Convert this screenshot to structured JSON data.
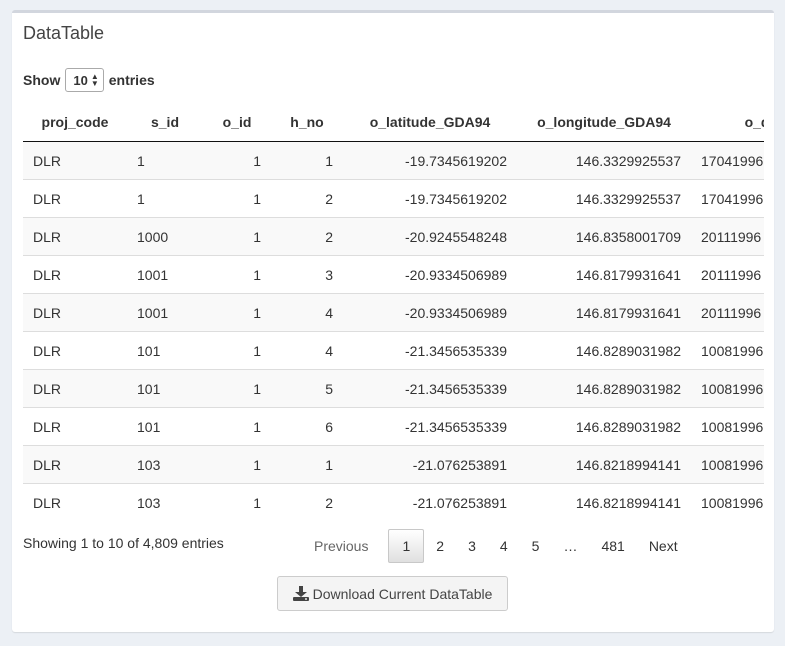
{
  "box": {
    "title": "DataTable"
  },
  "length": {
    "show_label": "Show",
    "selected": "10",
    "entries_label": "entries"
  },
  "table": {
    "headers": [
      "proj_code",
      "s_id",
      "o_id",
      "h_no",
      "o_latitude_GDA94",
      "o_longitude_GDA94",
      "o_date_desc"
    ],
    "rows": [
      [
        "DLR",
        "1",
        "1",
        "1",
        "-19.7345619202",
        "146.3329925537",
        "17041996"
      ],
      [
        "DLR",
        "1",
        "1",
        "2",
        "-19.7345619202",
        "146.3329925537",
        "17041996"
      ],
      [
        "DLR",
        "1000",
        "1",
        "2",
        "-20.9245548248",
        "146.8358001709",
        "20111996"
      ],
      [
        "DLR",
        "1001",
        "1",
        "3",
        "-20.9334506989",
        "146.8179931641",
        "20111996"
      ],
      [
        "DLR",
        "1001",
        "1",
        "4",
        "-20.9334506989",
        "146.8179931641",
        "20111996"
      ],
      [
        "DLR",
        "101",
        "1",
        "4",
        "-21.3456535339",
        "146.8289031982",
        "10081996"
      ],
      [
        "DLR",
        "101",
        "1",
        "5",
        "-21.3456535339",
        "146.8289031982",
        "10081996"
      ],
      [
        "DLR",
        "101",
        "1",
        "6",
        "-21.3456535339",
        "146.8289031982",
        "10081996"
      ],
      [
        "DLR",
        "103",
        "1",
        "1",
        "-21.076253891",
        "146.8218994141",
        "10081996"
      ],
      [
        "DLR",
        "103",
        "1",
        "2",
        "-21.076253891",
        "146.8218994141",
        "10081996"
      ]
    ]
  },
  "info": "Showing 1 to 10 of 4,809 entries",
  "pagination": {
    "previous": "Previous",
    "pages": [
      "1",
      "2",
      "3",
      "4",
      "5",
      "…",
      "481"
    ],
    "current": "1",
    "next": "Next"
  },
  "download_button": {
    "label": "Download Current DataTable",
    "icon": "download-icon"
  }
}
